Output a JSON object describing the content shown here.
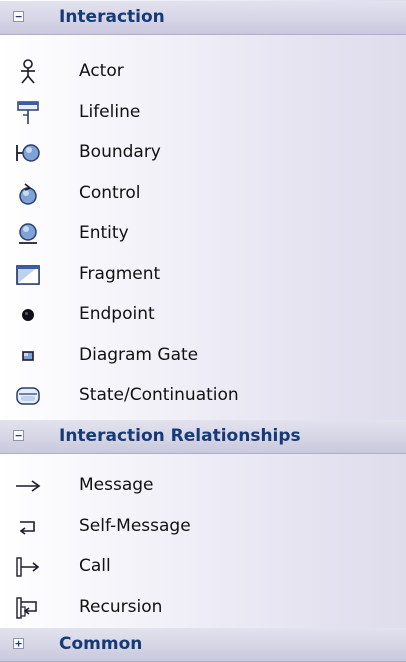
{
  "toolbox": {
    "sections": [
      {
        "title": "Interaction",
        "expanded": true,
        "toggle_symbol": "−",
        "items": [
          {
            "label": "Actor",
            "icon": "actor-icon"
          },
          {
            "label": "Lifeline",
            "icon": "lifeline-icon"
          },
          {
            "label": "Boundary",
            "icon": "boundary-icon"
          },
          {
            "label": "Control",
            "icon": "control-icon"
          },
          {
            "label": "Entity",
            "icon": "entity-icon"
          },
          {
            "label": "Fragment",
            "icon": "fragment-icon"
          },
          {
            "label": "Endpoint",
            "icon": "endpoint-icon"
          },
          {
            "label": "Diagram Gate",
            "icon": "diagram-gate-icon"
          },
          {
            "label": "State/Continuation",
            "icon": "state-continuation-icon"
          }
        ]
      },
      {
        "title": "Interaction Relationships",
        "expanded": true,
        "toggle_symbol": "−",
        "items": [
          {
            "label": "Message",
            "icon": "message-arrow-icon"
          },
          {
            "label": "Self-Message",
            "icon": "self-message-icon"
          },
          {
            "label": "Call",
            "icon": "call-icon"
          },
          {
            "label": "Recursion",
            "icon": "recursion-icon"
          }
        ]
      },
      {
        "title": "Common",
        "expanded": false,
        "toggle_symbol": "+",
        "items": []
      }
    ]
  },
  "colors": {
    "header_text": "#163a75",
    "item_text": "#111111",
    "icon_blue": "#3a5fa0",
    "icon_dark": "#1b1b2b"
  }
}
